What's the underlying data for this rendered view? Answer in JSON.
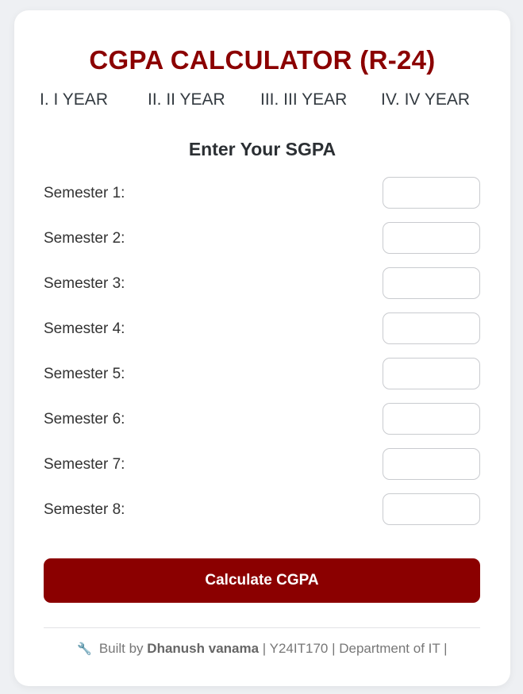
{
  "title": "CGPA CALCULATOR (R-24)",
  "years": [
    {
      "label": "I. I YEAR"
    },
    {
      "label": "II. II YEAR"
    },
    {
      "label": "III. III YEAR"
    },
    {
      "label": "IV. IV YEAR"
    }
  ],
  "subtitle": "Enter Your SGPA",
  "semesters": [
    {
      "label": "Semester 1:",
      "value": ""
    },
    {
      "label": "Semester 2:",
      "value": ""
    },
    {
      "label": "Semester 3:",
      "value": ""
    },
    {
      "label": "Semester 4:",
      "value": ""
    },
    {
      "label": "Semester 5:",
      "value": ""
    },
    {
      "label": "Semester 6:",
      "value": ""
    },
    {
      "label": "Semester 7:",
      "value": ""
    },
    {
      "label": "Semester 8:",
      "value": ""
    }
  ],
  "calculate_label": "Calculate CGPA",
  "footer": {
    "icon": "wrench-icon",
    "built_by": "Built by",
    "author": "Dhanush vanama",
    "rest": "| Y24IT170 | Department of IT |"
  },
  "colors": {
    "accent": "#8b0000",
    "background": "#eef0f3",
    "card": "#ffffff"
  }
}
